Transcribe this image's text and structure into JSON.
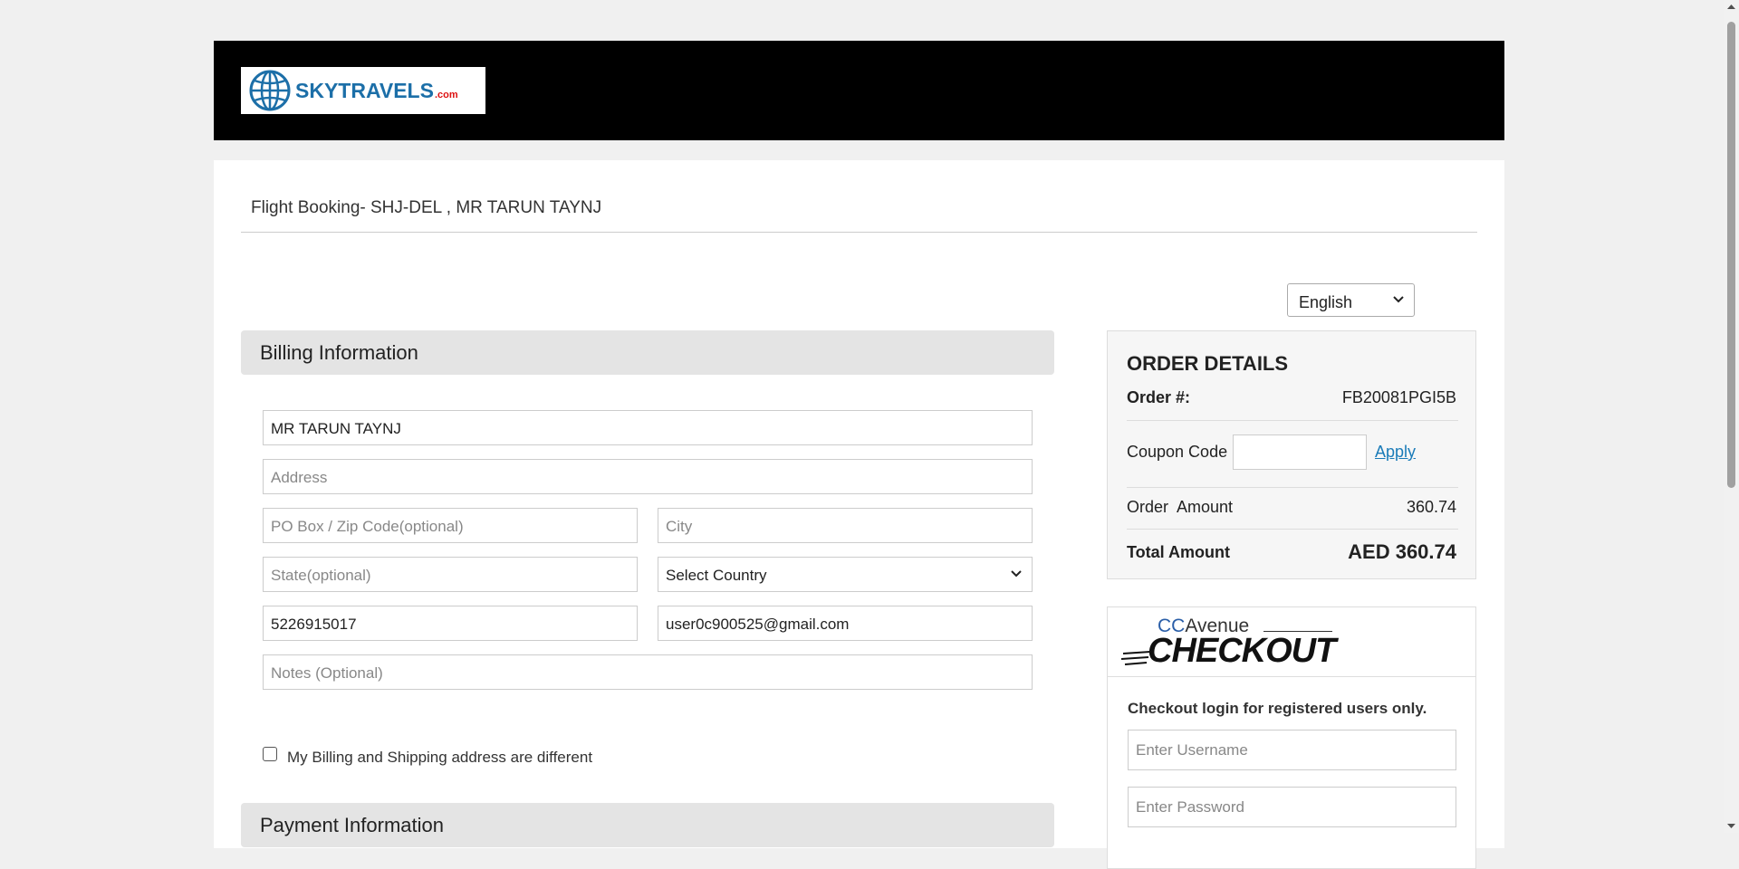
{
  "header": {
    "logo_text": "SKYTRAVELS",
    "logo_suffix": ".com"
  },
  "page": {
    "title": "Flight Booking- SHJ-DEL , MR TARUN TAYNJ",
    "language": "English"
  },
  "billing": {
    "heading": "Billing Information",
    "name_value": "MR TARUN TAYNJ",
    "address_placeholder": "Address",
    "zip_placeholder": "PO Box / Zip Code(optional)",
    "city_placeholder": "City",
    "state_placeholder": "State(optional)",
    "country_value": "Select Country",
    "phone_value": "5226915017",
    "email_value": "user0c900525@gmail.com",
    "notes_placeholder": "Notes (Optional)",
    "different_address_label": "My Billing and Shipping address are different"
  },
  "payment": {
    "heading": "Payment Information"
  },
  "order": {
    "heading": "ORDER DETAILS",
    "order_no_label": "Order #:",
    "order_no_value": "FB20081PGI5B",
    "coupon_label": "Coupon Code",
    "apply_label": "Apply",
    "amount_label": "Order  Amount",
    "amount_value": "360.74",
    "total_label": "Total Amount",
    "total_value": "AED 360.74"
  },
  "checkout": {
    "brand_cc": "CC",
    "brand_avenue": "Avenue",
    "brand_checkout": "CHECKOUT",
    "note": "Checkout login for registered users only.",
    "username_placeholder": "Enter Username",
    "password_placeholder": "Enter Password"
  },
  "colors": {
    "header_bg": "#000000",
    "link": "#1a7bb8",
    "section_bg": "#e4e4e4"
  }
}
